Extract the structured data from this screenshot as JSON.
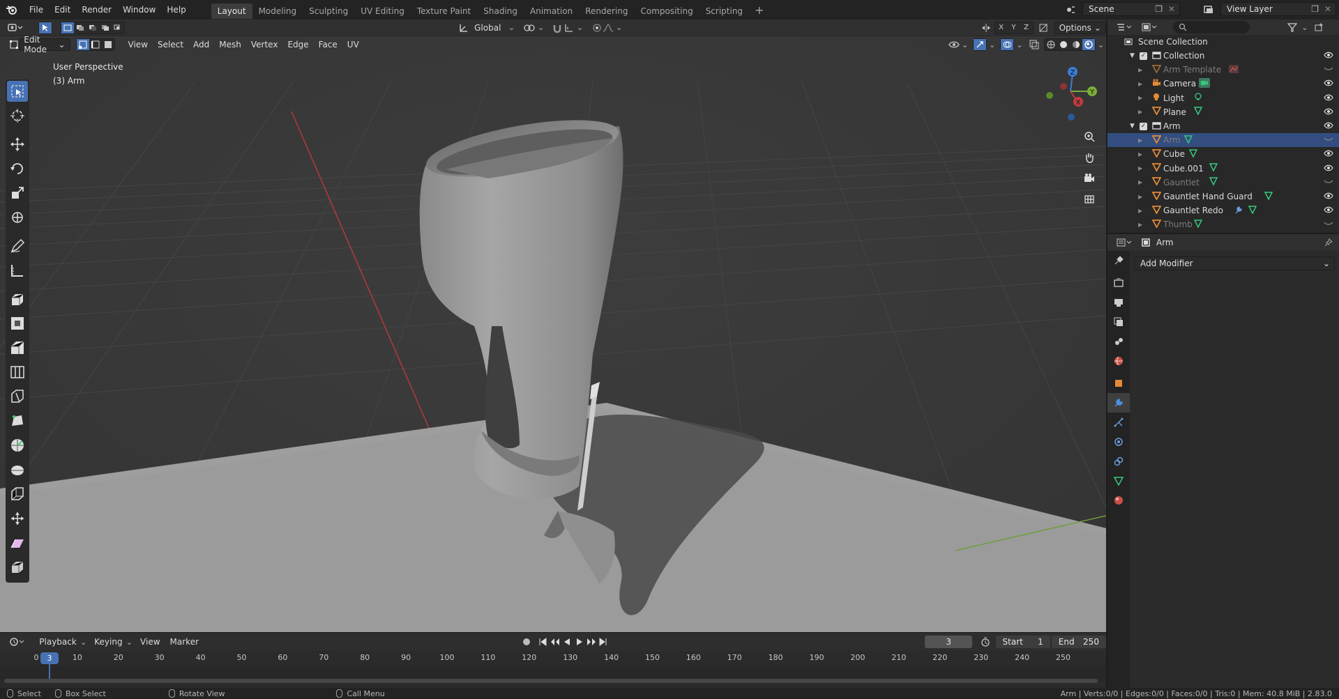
{
  "menubar": {
    "items": [
      "File",
      "Edit",
      "Render",
      "Window",
      "Help"
    ],
    "workspaces": [
      "Layout",
      "Modeling",
      "Sculpting",
      "UV Editing",
      "Texture Paint",
      "Shading",
      "Animation",
      "Rendering",
      "Compositing",
      "Scripting"
    ],
    "active_workspace": "Layout",
    "add_tab": "+",
    "scene": "Scene",
    "view_layer": "View Layer"
  },
  "viewport": {
    "mode": "Edit Mode",
    "menus": [
      "View",
      "Select",
      "Add",
      "Mesh",
      "Vertex",
      "Edge",
      "Face",
      "UV"
    ],
    "transform_orientation": "Global",
    "axis_labels": [
      "X",
      "Y",
      "Z"
    ],
    "options_label": "Options",
    "perspective_label": "User Perspective",
    "object_label": "(3) Arm",
    "gizmo": {
      "x": "X",
      "y": "Y",
      "z": "Z"
    }
  },
  "timeline": {
    "menus": [
      "Playback",
      "Keying",
      "View",
      "Marker"
    ],
    "current_frame": "3",
    "start_label": "Start",
    "start": "1",
    "end_label": "End",
    "end": "250",
    "ruler": [
      "0",
      "10",
      "20",
      "30",
      "40",
      "50",
      "60",
      "70",
      "80",
      "90",
      "100",
      "110",
      "120",
      "130",
      "140",
      "150",
      "160",
      "170",
      "180",
      "190",
      "200",
      "210",
      "220",
      "230",
      "240",
      "250"
    ],
    "playhead": "3"
  },
  "statusbar": {
    "select": "Select",
    "box_select": "Box Select",
    "rotate_view": "Rotate View",
    "call_menu": "Call Menu",
    "stats": "Arm | Verts:0/0 | Edges:0/0 | Faces:0/0 | Tris:0 | Mem: 40.8 MiB | 2.83.0"
  },
  "outliner": {
    "root": "Scene Collection",
    "rows": [
      {
        "name": "Collection",
        "type": "collection",
        "visible": true,
        "dim": false,
        "selected": false
      },
      {
        "name": "Arm Template",
        "type": "object",
        "visible": false,
        "dim": true,
        "selected": false
      },
      {
        "name": "Camera",
        "type": "camera",
        "visible": true,
        "dim": false,
        "selected": false
      },
      {
        "name": "Light",
        "type": "light",
        "visible": true,
        "dim": false,
        "selected": false
      },
      {
        "name": "Plane",
        "type": "mesh",
        "visible": true,
        "dim": false,
        "selected": false
      },
      {
        "name": "Arm",
        "type": "collection",
        "visible": true,
        "dim": false,
        "selected": false
      },
      {
        "name": "Arm",
        "type": "mesh",
        "visible": false,
        "dim": true,
        "selected": true
      },
      {
        "name": "Cube",
        "type": "mesh",
        "visible": true,
        "dim": false,
        "selected": false
      },
      {
        "name": "Cube.001",
        "type": "mesh",
        "visible": true,
        "dim": false,
        "selected": false
      },
      {
        "name": "Gauntlet",
        "type": "mesh",
        "visible": false,
        "dim": true,
        "selected": false
      },
      {
        "name": "Gauntlet Hand Guard",
        "type": "mesh",
        "visible": true,
        "dim": false,
        "selected": false
      },
      {
        "name": "Gauntlet Redo",
        "type": "mesh",
        "visible": true,
        "dim": false,
        "selected": false
      },
      {
        "name": "Thumb",
        "type": "mesh",
        "visible": false,
        "dim": true,
        "selected": false
      }
    ]
  },
  "properties": {
    "object_name": "Arm",
    "add_modifier": "Add Modifier"
  },
  "colors": {
    "accent": "#4772b3",
    "x_axis": "#c43c3c",
    "y_axis": "#7bae3a",
    "z_axis": "#3c7ed8",
    "mesh_icon": "#e38b38",
    "data_icon": "#36c97f"
  }
}
